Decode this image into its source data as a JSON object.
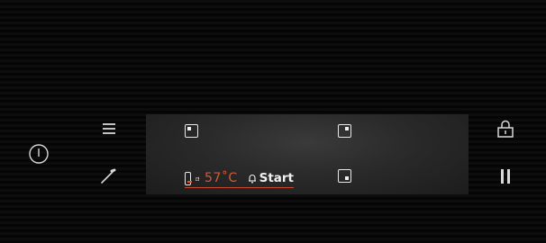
{
  "panel": {
    "left_controls": [
      {
        "name": "power-icon"
      },
      {
        "name": "menu-icon"
      },
      {
        "name": "probe-icon"
      }
    ],
    "right_controls": [
      {
        "name": "lock-icon"
      },
      {
        "name": "pause-icon"
      }
    ],
    "display": {
      "slots": [
        {
          "name": "shelf-top-left-icon"
        },
        {
          "name": "shelf-top-right-icon"
        },
        {
          "name": "shelf-bottom-right-icon"
        }
      ],
      "status": {
        "mode_icon": "heating-mode-icon",
        "probe_icon": "core-probe-icon",
        "temperature": "57˚C",
        "start_icon": "bell-icon",
        "start_label": "Start"
      }
    },
    "colors": {
      "accent": "#d45a36",
      "underline": "#c94a2c",
      "icon": "#e8e8e8",
      "display_bg": "#2a2a2a",
      "background": "#0b0b0b"
    }
  }
}
